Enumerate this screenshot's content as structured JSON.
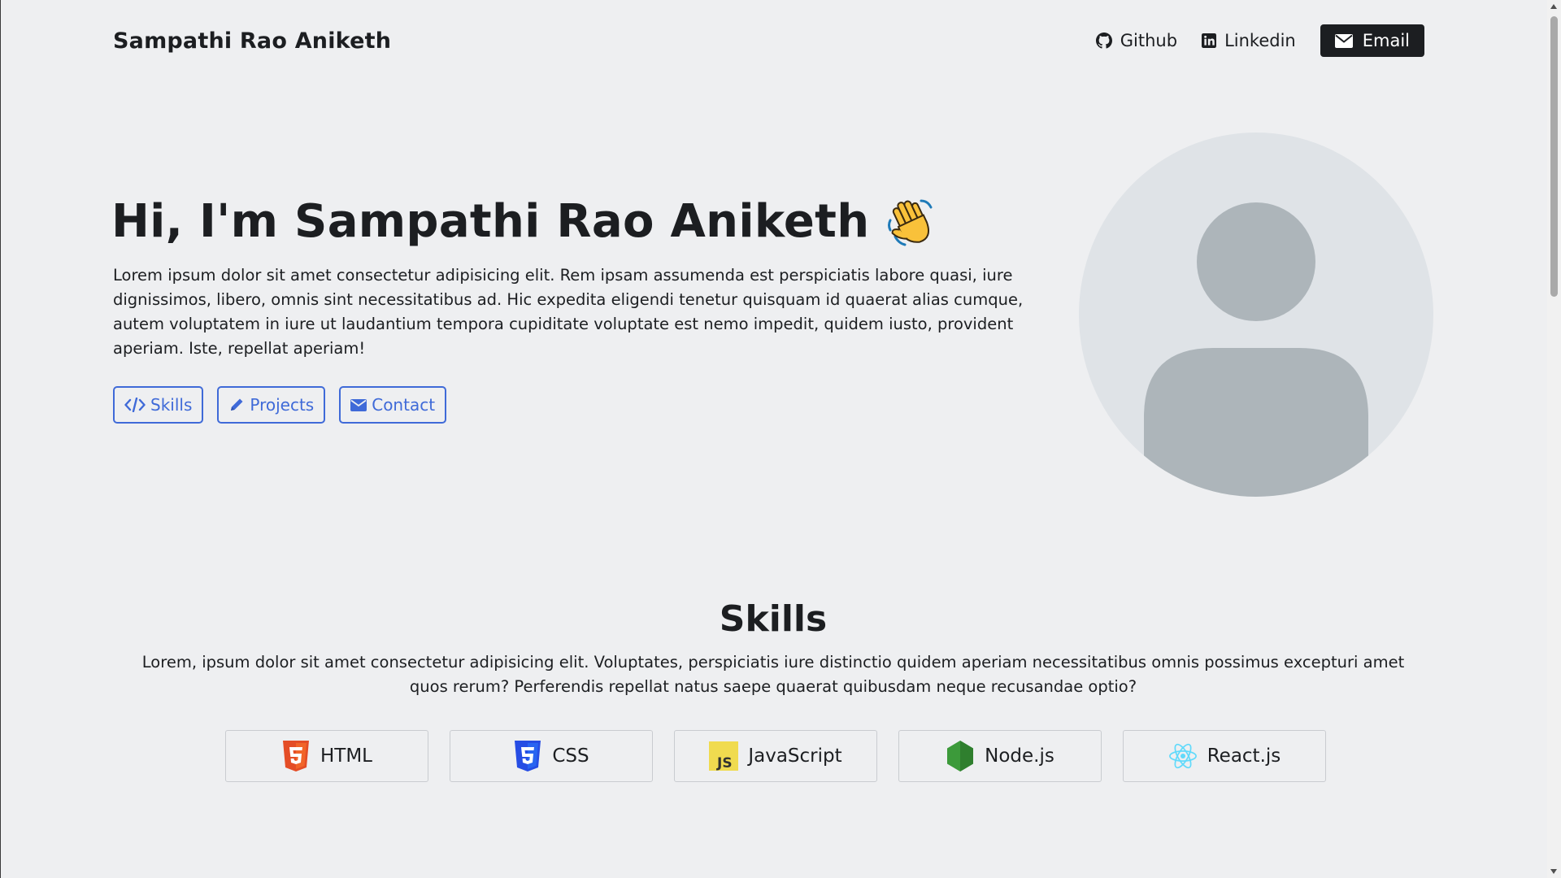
{
  "navbar": {
    "brand": "Sampathi Rao Aniketh",
    "links": {
      "github": "Github",
      "linkedin": "Linkedin",
      "email": "Email"
    }
  },
  "hero": {
    "title": "Hi, I'm Sampathi Rao Aniketh",
    "emoji": "waving-hand",
    "description": "Lorem ipsum dolor sit amet consectetur adipisicing elit. Rem ipsam assumenda est perspiciatis labore quasi, iure dignissimos, libero, omnis sint necessitatibus ad. Hic expedita eligendi tenetur quisquam id quaerat alias cumque, autem voluptatem in iure ut laudantium tempora cupiditate voluptate est nemo impedit, quidem iusto, provident aperiam. Iste, repellat aperiam!",
    "buttons": {
      "skills": "Skills",
      "projects": "Projects",
      "contact": "Contact"
    }
  },
  "skills": {
    "title": "Skills",
    "description": "Lorem, ipsum dolor sit amet consectetur adipisicing elit. Voluptates, perspiciatis iure distinctio quidem aperiam necessitatibus omnis possimus excepturi amet quos rerum? Perferendis repellat natus saepe quaerat quibusdam neque recusandae optio?",
    "items": [
      {
        "label": "HTML",
        "icon": "html5-icon"
      },
      {
        "label": "CSS",
        "icon": "css3-icon"
      },
      {
        "label": "JavaScript",
        "icon": "javascript-icon"
      },
      {
        "label": "Node.js",
        "icon": "nodejs-icon"
      },
      {
        "label": "React.js",
        "icon": "react-icon"
      }
    ]
  },
  "colors": {
    "background": "#eeeff1",
    "accent": "#3f6ad8",
    "dark": "#1c1e21",
    "avatar_bg": "#dfe3e7",
    "avatar_fg": "#adb5ba"
  }
}
